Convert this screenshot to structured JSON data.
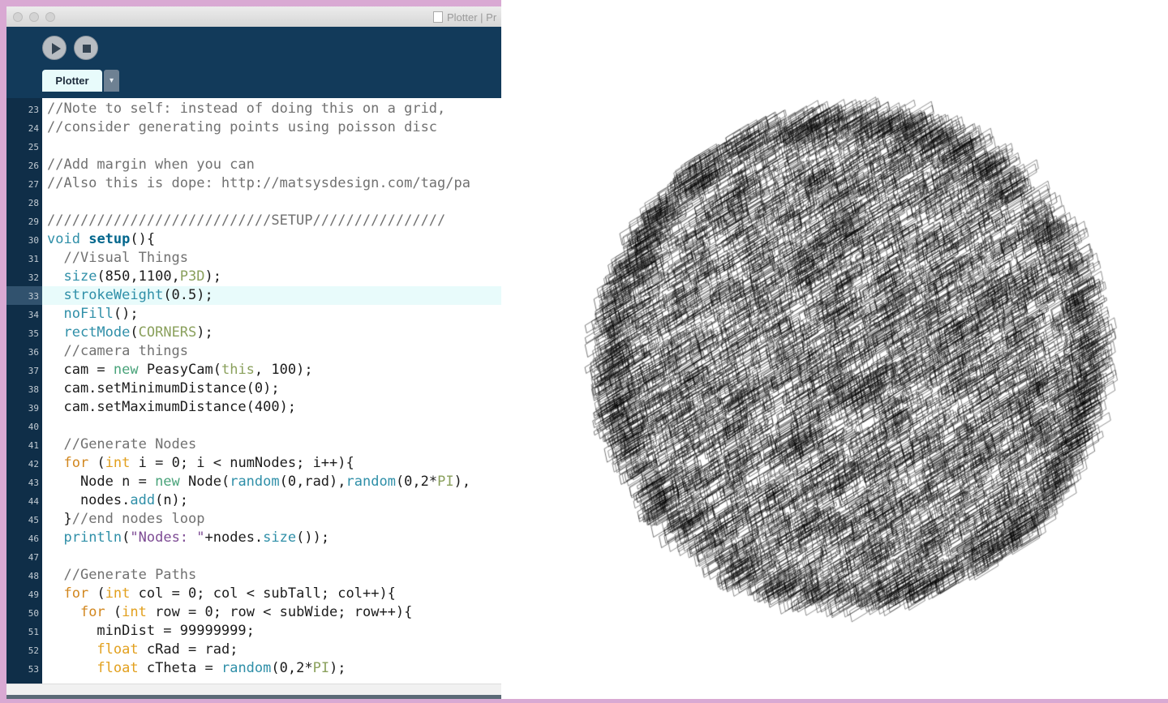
{
  "window": {
    "title": "Plotter | Pr",
    "tab_label": "Plotter",
    "tab_menu_glyph": "▾"
  },
  "toolbar": {
    "run_icon": "play-icon",
    "stop_icon": "stop-icon"
  },
  "editor": {
    "current_line": 33,
    "lines": [
      {
        "n": "23",
        "html": "<span class=\"cm\">//Note to self: instead of doing this on a grid,</span>"
      },
      {
        "n": "24",
        "html": "<span class=\"cm\">//consider generating points using poisson disc</span>"
      },
      {
        "n": "25",
        "html": ""
      },
      {
        "n": "26",
        "html": "<span class=\"cm\">//Add margin when you can</span>"
      },
      {
        "n": "27",
        "html": "<span class=\"cm\">//Also this is dope: http://matsysdesign.com/tag/pa</span>"
      },
      {
        "n": "28",
        "html": ""
      },
      {
        "n": "29",
        "html": "<span class=\"cm\">///////////////////////////SETUP////////////////</span>"
      },
      {
        "n": "30",
        "html": "<span class=\"k\">void</span> <span class=\"kb\">setup</span>(){"
      },
      {
        "n": "31",
        "html": "  <span class=\"cm\">//Visual Things</span>"
      },
      {
        "n": "32",
        "html": "  <span class=\"k\">size</span>(850,1100,<span class=\"gr\">P3D</span>);"
      },
      {
        "n": "33",
        "html": "  <span class=\"k\">strokeWeight</span>(0.5);"
      },
      {
        "n": "34",
        "html": "  <span class=\"k\">noFill</span>();"
      },
      {
        "n": "35",
        "html": "  <span class=\"k\">rectMode</span>(<span class=\"gr\">CORNERS</span>);"
      },
      {
        "n": "36",
        "html": "  <span class=\"cm\">//camera things</span>"
      },
      {
        "n": "37",
        "html": "  cam = <span class=\"nw\">new</span> PeasyCam(<span class=\"gr\">this</span>, 100);"
      },
      {
        "n": "38",
        "html": "  cam.setMinimumDistance(0);"
      },
      {
        "n": "39",
        "html": "  cam.setMaximumDistance(400);"
      },
      {
        "n": "40",
        "html": ""
      },
      {
        "n": "41",
        "html": "  <span class=\"cm\">//Generate Nodes</span>"
      },
      {
        "n": "42",
        "html": "  <span class=\"kf\">for</span> (<span class=\"ty\">int</span> i = 0; i &lt; numNodes; i++){"
      },
      {
        "n": "43",
        "html": "    Node n = <span class=\"nw\">new</span> Node(<span class=\"k\">random</span>(0,rad),<span class=\"k\">random</span>(0,2*<span class=\"gr\">PI</span>),"
      },
      {
        "n": "44",
        "html": "    nodes.<span class=\"k\">add</span>(n);"
      },
      {
        "n": "45",
        "html": "  }<span class=\"cm\">//end nodes loop</span>"
      },
      {
        "n": "46",
        "html": "  <span class=\"k\">println</span>(<span class=\"st\">\"Nodes: \"</span>+nodes.<span class=\"k\">size</span>());"
      },
      {
        "n": "47",
        "html": ""
      },
      {
        "n": "48",
        "html": "  <span class=\"cm\">//Generate Paths</span>"
      },
      {
        "n": "49",
        "html": "  <span class=\"kf\">for</span> (<span class=\"ty\">int</span> col = 0; col &lt; subTall; col++){"
      },
      {
        "n": "50",
        "html": "    <span class=\"kf\">for</span> (<span class=\"ty\">int</span> row = 0; row &lt; subWide; row++){"
      },
      {
        "n": "51",
        "html": "      minDist = 99999999;"
      },
      {
        "n": "52",
        "html": "      <span class=\"ty\">float</span> cRad = rad;"
      },
      {
        "n": "53",
        "html": "      <span class=\"ty\">float</span> cTheta = <span class=\"k\">random</span>(0,2*<span class=\"gr\">PI</span>);"
      }
    ]
  },
  "sketch": {
    "description_icon": "plotter-sphere-output"
  }
}
